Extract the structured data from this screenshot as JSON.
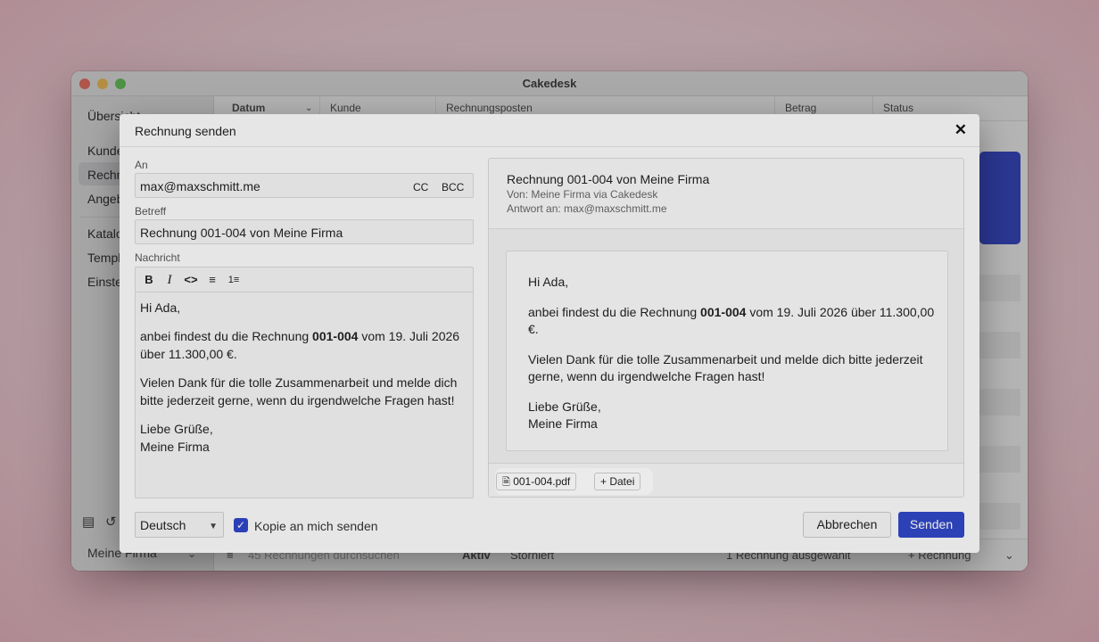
{
  "app": {
    "title": "Cakedesk",
    "sidebar": {
      "items": [
        "Übersicht",
        "Kunden",
        "Rechnungen",
        "Angebote",
        "Katalog",
        "Templates",
        "Einstellungen"
      ],
      "account": "Meine Firma"
    },
    "columns": [
      "Datum",
      "Kunde",
      "Rechnungsposten",
      "Betrag",
      "Status"
    ],
    "bottom_bar": {
      "search_placeholder": "45 Rechnungen durchsuchen",
      "filter_active": "Aktiv",
      "filter_cancelled": "Storniert",
      "selection_info": "1 Rechnung ausgewählt",
      "new_button": "+ Rechnung"
    }
  },
  "dialog": {
    "title": "Rechnung senden",
    "to_label": "An",
    "to_value": "max@maxschmitt.me",
    "cc_label": "CC",
    "bcc_label": "BCC",
    "subject_label": "Betreff",
    "subject_value": "Rechnung 001-004 von Meine Firma",
    "message_label": "Nachricht",
    "message": {
      "greeting": "Hi Ada,",
      "line1_pre": "anbei findest du die Rechnung ",
      "line1_bold": "001-004",
      "line1_post": " vom 19. Juli 2026 über 11.300,00 €.",
      "line2": "Vielen Dank für die tolle Zusammenarbeit und melde dich bitte jederzeit gerne, wenn du irgendwelche Fragen hast!",
      "closing1": "Liebe Grüße,",
      "closing2": "Meine Firma"
    },
    "preview": {
      "subject": "Rechnung 001-004 von Meine Firma",
      "from": "Von: Meine Firma via Cakedesk",
      "reply_to": "Antwort an: max@maxschmitt.me"
    },
    "attachments": {
      "file": "001-004.pdf",
      "add_file": "+ Datei"
    },
    "language": "Deutsch",
    "copy_label": "Kopie an mich senden",
    "cancel_label": "Abbrechen",
    "send_label": "Senden"
  },
  "colors": {
    "accent": "#3047c6",
    "highlight": "#ffffff"
  }
}
